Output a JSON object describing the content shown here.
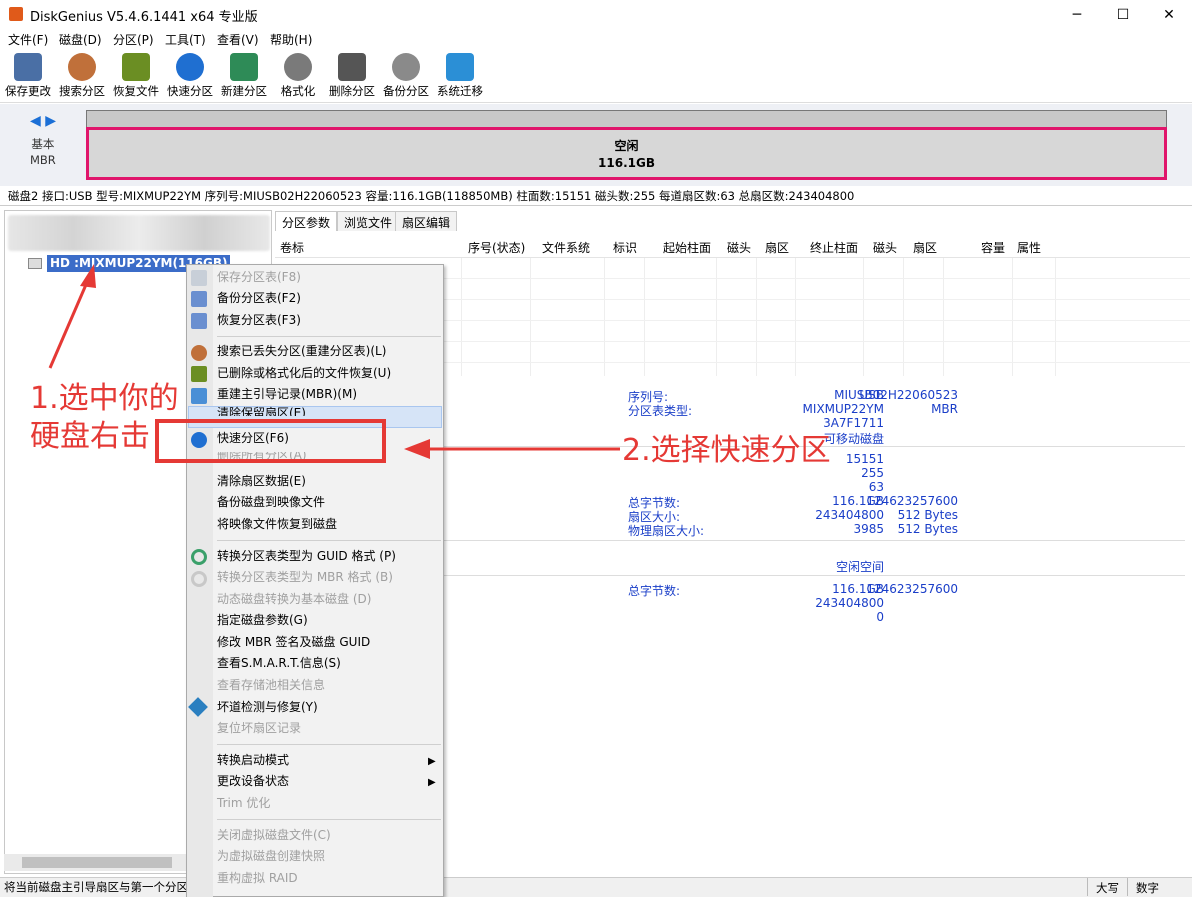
{
  "window": {
    "title": "DiskGenius V5.4.6.1441 x64 专业版",
    "minimize": "─",
    "maximize": "☐",
    "close": "✕"
  },
  "menu": [
    "文件(F)",
    "磁盘(D)",
    "分区(P)",
    "工具(T)",
    "查看(V)",
    "帮助(H)"
  ],
  "toolbar": [
    {
      "label": "保存更改",
      "icon": "save-icon",
      "color": "#4a6fa5"
    },
    {
      "label": "搜索分区",
      "icon": "search-icon",
      "color": "#c0703a"
    },
    {
      "label": "恢复文件",
      "icon": "restore-icon",
      "color": "#6b8e23"
    },
    {
      "label": "快速分区",
      "icon": "quick-partition-icon",
      "color": "#1f6fd1"
    },
    {
      "label": "新建分区",
      "icon": "new-partition-icon",
      "color": "#2e8b57"
    },
    {
      "label": "格式化",
      "icon": "format-icon",
      "color": "#7a7a7a"
    },
    {
      "label": "删除分区",
      "icon": "delete-icon",
      "color": "#555555"
    },
    {
      "label": "备份分区",
      "icon": "backup-icon",
      "color": "#8a8a8a"
    },
    {
      "label": "系统迁移",
      "icon": "migrate-icon",
      "color": "#2b8fd6"
    }
  ],
  "diskmap": {
    "nav": "◀ ▶",
    "type": "基本",
    "scheme": "MBR",
    "partition_name": "空闲",
    "partition_size": "116.1GB"
  },
  "info": "磁盘2 接口:USB  型号:MIXMUP22YM  序列号:MIUSB02H22060523  容量:116.1GB(118850MB)  柱面数:15151  磁头数:255  每道扇区数:63  总扇区数:243404800",
  "tree": {
    "disk_label": "HD :MIXMUP22YM(116GB)"
  },
  "tabs": [
    "分区参数",
    "浏览文件",
    "扇区编辑"
  ],
  "columns": [
    "卷标",
    "序号(状态)",
    "文件系统",
    "标识",
    "起始柱面",
    "磁头",
    "扇区",
    "终止柱面",
    "磁头",
    "扇区",
    "容量",
    "属性"
  ],
  "details": {
    "v1": "USB",
    "v2": "MIXMUP22YM",
    "v3": "3A7F1711",
    "v4": "可移动磁盘",
    "l_serial": "序列号:",
    "serial": "MIUSB02H22060523",
    "l_ptype": "分区表类型:",
    "ptype": "MBR",
    "cyl": "15151",
    "heads": "255",
    "sectors": "63",
    "cap": "116.1GB",
    "total_sectors": "243404800",
    "x3985": "3985",
    "l_bytes": "总字节数:",
    "bytes": "124623257600",
    "l_secsize": "扇区大小:",
    "secsize": "512 Bytes",
    "l_physsize": "物理扇区大小:",
    "physsize": "512 Bytes",
    "free_label": "空闲空间",
    "cap2": "116.1GB",
    "total2": "243404800",
    "zero": "0",
    "l_bytes2": "总字节数:",
    "bytes2": "124623257600"
  },
  "context_menu": [
    {
      "label": "保存分区表(F8)",
      "enabled": false
    },
    {
      "label": "备份分区表(F2)",
      "enabled": true
    },
    {
      "label": "恢复分区表(F3)",
      "enabled": true
    },
    {
      "label": "搜索已丢失分区(重建分区表)(L)",
      "enabled": true
    },
    {
      "label": "已删除或格式化后的文件恢复(U)",
      "enabled": true
    },
    {
      "label": "重建主引导记录(MBR)(M)",
      "enabled": true
    },
    {
      "label": "清除保留扇区(E)",
      "enabled": true
    },
    {
      "label": "快速分区(F6)",
      "enabled": true
    },
    {
      "label": "删除所有分区(A)",
      "enabled": false
    },
    {
      "label": "清除扇区数据(E)",
      "enabled": true
    },
    {
      "label": "备份磁盘到映像文件",
      "enabled": true
    },
    {
      "label": "将映像文件恢复到磁盘",
      "enabled": true
    },
    {
      "label": "转换分区表类型为 GUID 格式 (P)",
      "enabled": true
    },
    {
      "label": "转换分区表类型为 MBR 格式 (B)",
      "enabled": false
    },
    {
      "label": "动态磁盘转换为基本磁盘 (D)",
      "enabled": false
    },
    {
      "label": "指定磁盘参数(G)",
      "enabled": true
    },
    {
      "label": "修改 MBR 签名及磁盘 GUID",
      "enabled": true
    },
    {
      "label": "查看S.M.A.R.T.信息(S)",
      "enabled": true
    },
    {
      "label": "查看存储池相关信息",
      "enabled": false
    },
    {
      "label": "坏道检测与修复(Y)",
      "enabled": true
    },
    {
      "label": "复位坏扇区记录",
      "enabled": false
    },
    {
      "label": "转换启动模式",
      "enabled": true,
      "submenu": true
    },
    {
      "label": "更改设备状态",
      "enabled": true,
      "submenu": true
    },
    {
      "label": "Trim 优化",
      "enabled": false
    },
    {
      "label": "关闭虚拟磁盘文件(C)",
      "enabled": false
    },
    {
      "label": "为虚拟磁盘创建快照",
      "enabled": false
    },
    {
      "label": "重构虚拟 RAID",
      "enabled": false
    }
  ],
  "annotations": {
    "step1a": "1.选中你的",
    "step1b": "硬盘右击",
    "step2": "2.选择快速分区"
  },
  "status": {
    "text": "将当前磁盘主引导扇区与第一个分区",
    "caps": "大写",
    "num": "数字"
  }
}
